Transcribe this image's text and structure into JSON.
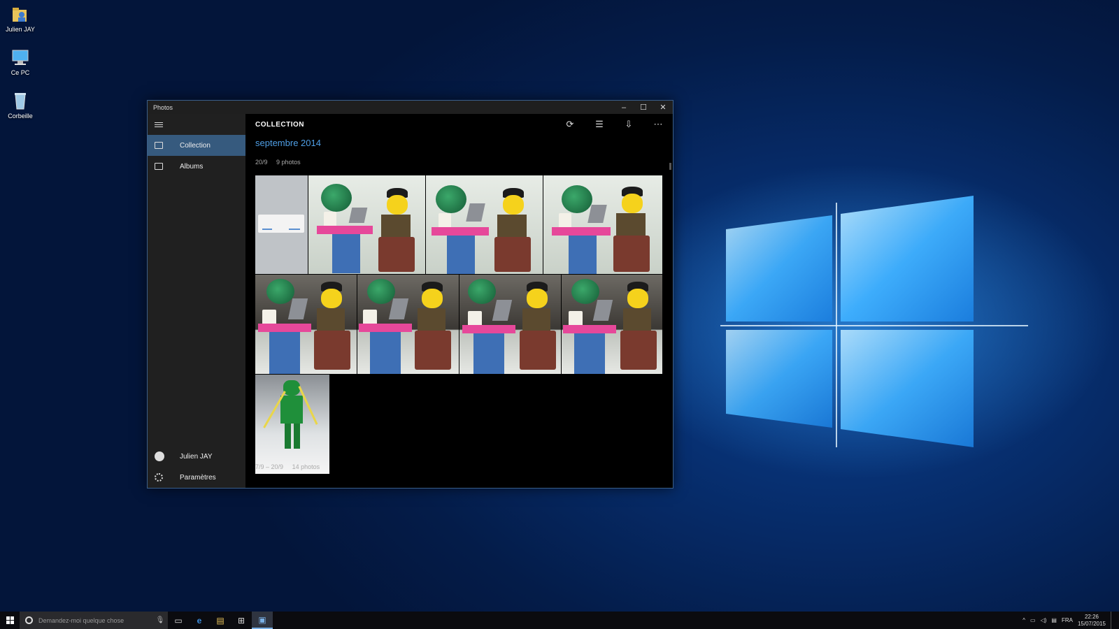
{
  "desktop": {
    "icons": [
      {
        "label": "Julien JAY",
        "icon": "user-folder-icon"
      },
      {
        "label": "Ce PC",
        "icon": "computer-icon"
      },
      {
        "label": "Corbeille",
        "icon": "recycle-bin-icon"
      }
    ]
  },
  "window": {
    "title": "Photos",
    "controls": {
      "minimize": "–",
      "maximize": "☐",
      "close": "✕"
    }
  },
  "sidebar": {
    "items": [
      {
        "label": "Collection",
        "icon": "collection-icon",
        "active": true
      },
      {
        "label": "Albums",
        "icon": "albums-icon",
        "active": false
      }
    ],
    "bottom": [
      {
        "label": "Julien JAY",
        "icon": "avatar"
      },
      {
        "label": "Paramètres",
        "icon": "gear-icon"
      }
    ]
  },
  "header": {
    "title": "COLLECTION",
    "tools": [
      {
        "icon": "refresh-icon",
        "glyph": "⟳"
      },
      {
        "icon": "select-icon",
        "glyph": "☰"
      },
      {
        "icon": "import-icon",
        "glyph": "⇩"
      },
      {
        "icon": "more-icon",
        "glyph": "⋯"
      }
    ]
  },
  "content": {
    "month": "septembre 2014",
    "groups": [
      {
        "date": "20/9",
        "count": "9 photos"
      },
      {
        "date": "7/9 – 20/9",
        "count": "14 photos"
      }
    ]
  },
  "taskbar": {
    "search_placeholder": "Demandez-moi quelque chose",
    "mic_glyph": "🎙",
    "apps": [
      {
        "icon": "task-view-icon",
        "glyph": "▭"
      },
      {
        "icon": "edge-icon",
        "glyph": "e"
      },
      {
        "icon": "file-explorer-icon",
        "glyph": "▤"
      },
      {
        "icon": "store-icon",
        "glyph": "⊞"
      },
      {
        "icon": "photos-app-icon",
        "glyph": "▣"
      }
    ],
    "tray": {
      "chevron": "^",
      "language": "FRA",
      "time": "22:26",
      "date": "15/07/2015"
    }
  },
  "colors": {
    "accent": "#365a7e",
    "month_link": "#4f9fe6"
  }
}
